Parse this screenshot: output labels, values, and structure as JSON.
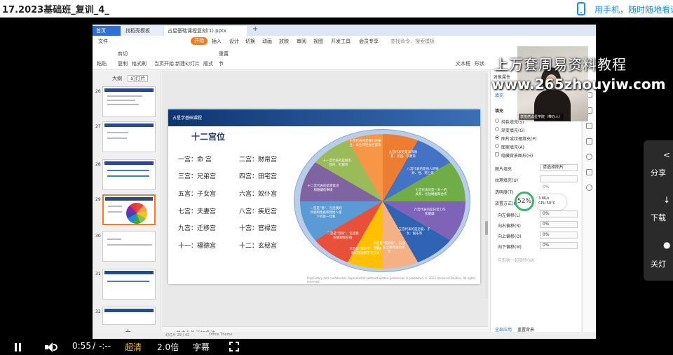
{
  "page": {
    "title": "17.2023基础班_复训_4_",
    "mobile_promo": "用手机，随时随地看课"
  },
  "wps": {
    "tabs": [
      "首页",
      "找稻壳模板",
      "占星基础课程复刻(1).pptx"
    ],
    "menu": [
      "文件",
      "开始",
      "插入",
      "设计",
      "切换",
      "动画",
      "放映",
      "审阅",
      "视图",
      "开发工具",
      "会员专享",
      "查找命令、搜索模板"
    ],
    "ribbon": {
      "paste": "粘贴",
      "cut": "剪切",
      "copy": "复制",
      "format_painter": "格式刷",
      "play": "当页开始",
      "new_slide": "新建幻灯片",
      "layout": "版式",
      "section": "节",
      "reset": "重置",
      "textbox": "文本框",
      "shape": "形状"
    },
    "thumb_tabs": [
      "大纲",
      "幻灯片"
    ],
    "thumb_numbers": [
      "26",
      "27",
      "28",
      "29",
      "30",
      "31",
      "32"
    ],
    "notes_placeholder": "单击此处添加备注",
    "status_left": "幻灯片 29 / 42",
    "status_theme": "Office Theme"
  },
  "slide": {
    "header": "占星学基础课程",
    "title": "十二宫位",
    "houses_left": [
      "一宫：命 宫",
      "三宫：兄弟宫",
      "五宫：子女宫",
      "七宫：夫妻宫",
      "九宫：迁移宫",
      "十一：福德宫"
    ],
    "houses_right": [
      "二宫：财帛宫",
      "四宫：田宅宫",
      "六宫：奴仆宫",
      "八宫：疾厄宫",
      "十宫：官禄宫",
      "十二：玄秘宫"
    ],
    "pie_labels": [
      "十宫代表的是我们的事业、众业和社会名誉等",
      "九宫代表的是高等教育、外国、宗教等",
      "八宫代表的是他人的钱财、性、死亡等",
      "七宫代表的是一对一的关系、包括婚姻和合作",
      "六宫代表的是日常工作和健康",
      "五宫代表的是恋爱、子女、娱乐等",
      "四宫是“我的家”、包括家庭、安全感和家的环境",
      "三宫是“我的学”、包括我的沟通和学习方式",
      "二宫是“我的”、包括我的钱财和价值",
      "一宫是“我”、包括我的外貌和性格和我给人留下的第一印象",
      "十二宫代表的是潜意识和隐藏的事情",
      "十一宫代表的是朋友、团体、社群等"
    ],
    "footer": "Proprietary and confidential. Reproduction without written permission is prohibited. © 2023 Universal Studios. All rights reserved."
  },
  "props": {
    "title": "对象属性",
    "fill_tab": "填充",
    "fill_section": "填充",
    "options": [
      "纯色填充(S)",
      "渐变填充(G)",
      "图片或纹理填充(P)",
      "图案填充(A)",
      "隐藏背景图形(H)"
    ],
    "picture_fill_label": "图片填充",
    "picture_fill_value": "请选择图片",
    "texture_label": "纹理填充(U)",
    "transparency_label": "透明度(T)",
    "transparency_value": "0%",
    "placement_label": "放置方式(K)",
    "offsets": [
      {
        "label": "向左偏移(L)",
        "value": "0%"
      },
      {
        "label": "向右偏移(R)",
        "value": "0%"
      },
      {
        "label": "向上偏移(O)",
        "value": "0%"
      },
      {
        "label": "向下偏移(M)",
        "value": "0%"
      }
    ],
    "tile_label": "与形状一起旋转(W)",
    "apply_all": "全部应用",
    "reset_bg": "重置背景",
    "speed_value": "52",
    "speed_unit": "%",
    "net_up": "3.8K/s",
    "net_cpu": "CPU 59°C"
  },
  "webcam_label": "李悦然占星学院（带办人）",
  "watermark": {
    "line1": "上万套周易资料教程",
    "line2": "www.265zhouyiw.com"
  },
  "side_panel": [
    "分享",
    "下载",
    "关灯"
  ],
  "player": {
    "time": "0:55",
    "separator": "/",
    "duration": "-:--",
    "quality": "超清",
    "speed": "2.0倍",
    "subtitle": "字幕"
  }
}
